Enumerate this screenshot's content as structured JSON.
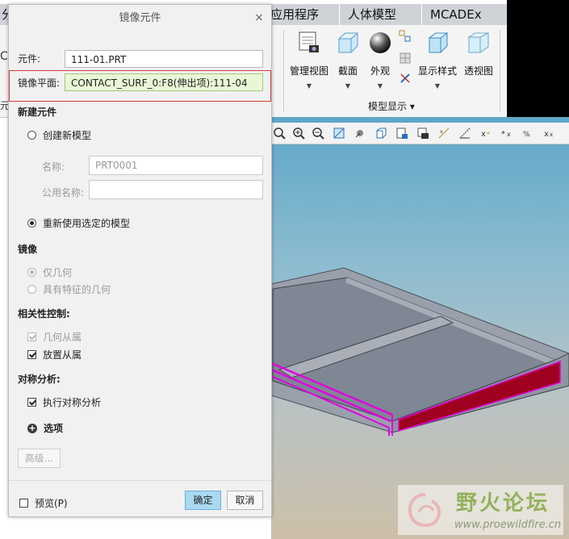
{
  "app": {
    "tabs": [
      "分",
      "应用程序",
      "人体模型",
      "MCADEx Too"
    ],
    "ribbon_items": [
      "管理视图",
      "截面",
      "外观",
      "显示样式",
      "透视图"
    ],
    "group_label": "模型显示",
    "watermark_title": "野火论坛",
    "watermark_url": "www.proewildfire.cn",
    "left_edge_glyphs": [
      "C",
      "元"
    ]
  },
  "dialog": {
    "title": "镜像元件",
    "close_symbol": "×",
    "component_label": "元件:",
    "component_value": "111-01.PRT",
    "mirror_plane_label": "镜像平面:",
    "mirror_plane_value": "CONTACT_SURF_0:F8(伸出项):111-04",
    "new_component": {
      "section_title": "新建元件",
      "create_new_label": "创建新模型",
      "name_label": "名称:",
      "name_value": "PRT0001",
      "common_name_label": "公用名称:",
      "common_name_value": "",
      "reuse_label": "重新使用选定的模型"
    },
    "mirror": {
      "section_title": "镜像",
      "geometry_only_label": "仅几何",
      "geometry_with_features_label": "具有特征的几何"
    },
    "dependency": {
      "section_title": "相关性控制:",
      "geometry_dependent_label": "几何从属",
      "placement_dependent_label": "放置从属"
    },
    "symmetry": {
      "section_title": "对称分析:",
      "run_analysis_label": "执行对称分析"
    },
    "options_label": "选项",
    "advanced_button": "高级...",
    "preview_label": "预览(P)",
    "ok_button": "确定",
    "cancel_button": "取消"
  },
  "colors": {
    "highlight_border": "#d23a3a",
    "active_field_bg": "#e9f7d6",
    "primary_button": "#aad9f2",
    "selection_edge": "#e000e0"
  }
}
